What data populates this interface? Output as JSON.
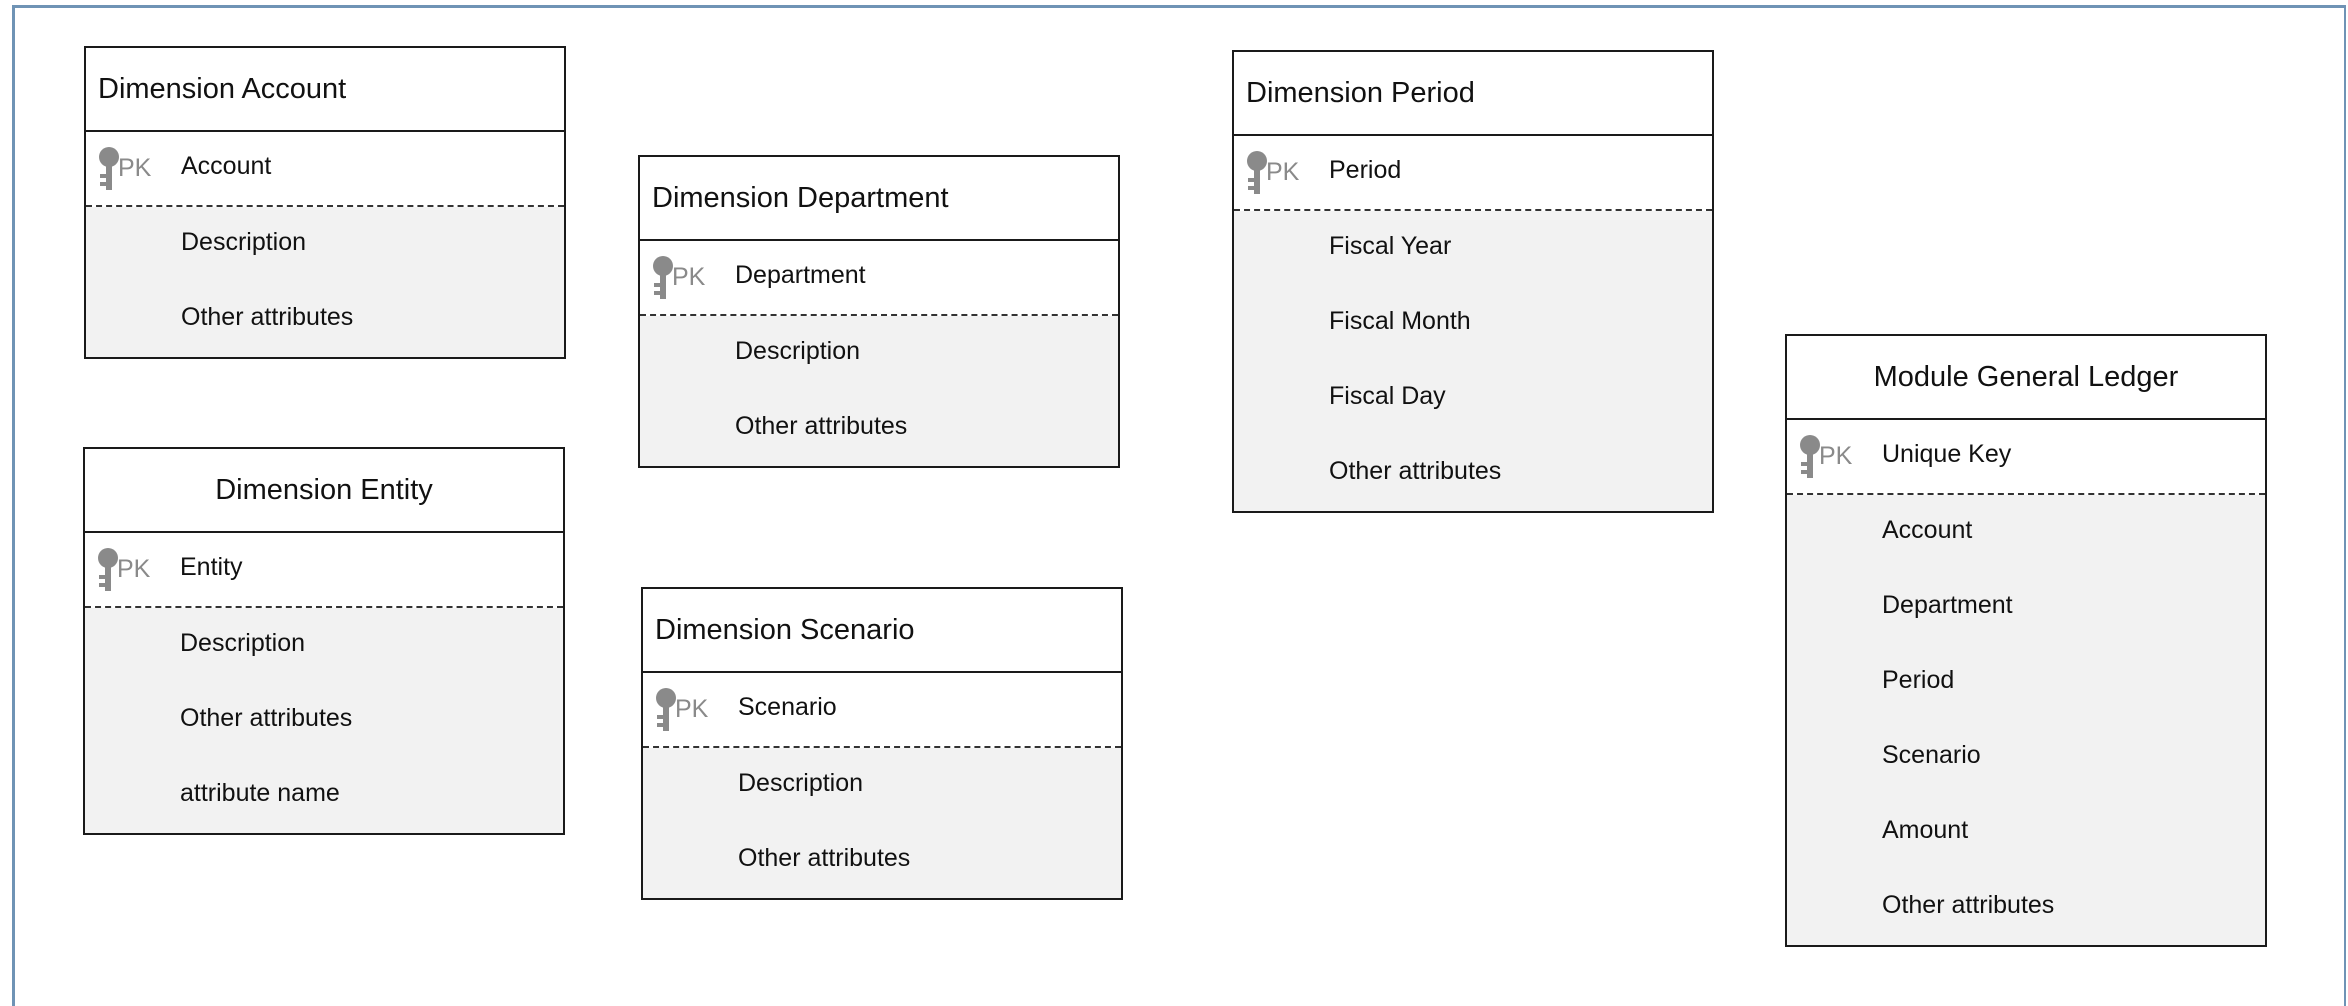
{
  "diagram": {
    "entities": [
      {
        "id": "dimension-account",
        "title": "Dimension Account",
        "pk_label": "PK",
        "key": "Account",
        "attributes": [
          "Description",
          "Other attributes"
        ]
      },
      {
        "id": "dimension-entity",
        "title": "Dimension Entity",
        "pk_label": "PK",
        "key": "Entity",
        "attributes": [
          "Description",
          "Other attributes",
          "attribute name"
        ]
      },
      {
        "id": "dimension-department",
        "title": "Dimension Department",
        "pk_label": "PK",
        "key": "Department",
        "attributes": [
          "Description",
          "Other attributes"
        ]
      },
      {
        "id": "dimension-scenario",
        "title": "Dimension Scenario",
        "pk_label": "PK",
        "key": "Scenario",
        "attributes": [
          "Description",
          "Other attributes"
        ]
      },
      {
        "id": "dimension-period",
        "title": "Dimension Period",
        "pk_label": "PK",
        "key": "Period",
        "attributes": [
          "Fiscal Year",
          "Fiscal Month",
          "Fiscal Day",
          "Other attributes"
        ]
      },
      {
        "id": "module-general-ledger",
        "title": "Module General Ledger",
        "pk_label": "PK",
        "key": "Unique Key",
        "attributes": [
          "Account",
          "Department",
          "Period",
          "Scenario",
          "Amount",
          "Other attributes"
        ]
      }
    ]
  },
  "colors": {
    "border": "#1a1a1a",
    "body_fill": "#f2f2f2",
    "key_icon": "#8a8a8a",
    "frame": "#6f93b5"
  }
}
